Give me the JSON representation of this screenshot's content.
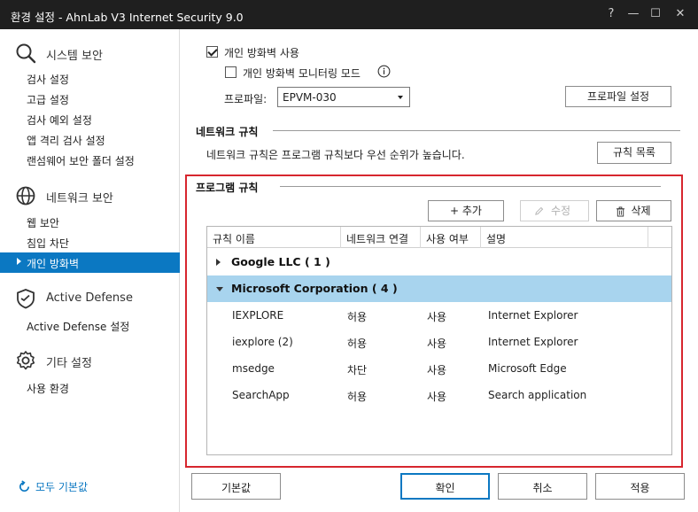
{
  "window": {
    "title": "환경 설정 - AhnLab V3 Internet Security 9.0",
    "help": "?",
    "minimize": "—",
    "maximize": "☐",
    "close": "✕"
  },
  "sidebar": {
    "sections": [
      {
        "title": "시스템 보안",
        "icon": "search-icon",
        "items": [
          "검사 설정",
          "고급 설정",
          "검사 예외 설정",
          "앱 격리 검사 설정",
          "랜섬웨어 보안 폴더 설정"
        ]
      },
      {
        "title": "네트워크 보안",
        "icon": "globe-icon",
        "items": [
          "웹 보안",
          "침입 차단",
          "개인 방화벽"
        ]
      },
      {
        "title": "Active Defense",
        "icon": "shield-icon",
        "items": [
          "Active Defense 설정"
        ]
      },
      {
        "title": "기타 설정",
        "icon": "gear-icon",
        "items": [
          "사용 환경"
        ]
      }
    ],
    "active_item": "개인 방화벽",
    "reset_all": "모두 기본값"
  },
  "firewall": {
    "enable_label": "개인 방화벽 사용",
    "enable_checked": true,
    "monitor_label": "개인 방화벽 모니터링 모드",
    "monitor_checked": false,
    "profile_label": "프로파일:",
    "profile_value": "EPVM-030",
    "profile_settings_button": "프로파일 설정"
  },
  "network_rules": {
    "title": "네트워크 규칙",
    "description": "네트워크 규칙은 프로그램 규칙보다 우선 순위가 높습니다.",
    "list_button": "규칙 목록"
  },
  "program_rules": {
    "title": "프로그램 규칙",
    "add_button": "+ 추가",
    "edit_button": "수정",
    "delete_button": "삭제",
    "columns": [
      "규칙 이름",
      "네트워크 연결",
      "사용 여부",
      "설명"
    ],
    "groups": [
      {
        "name": "Google LLC ( 1 )",
        "expanded": false,
        "selected": false,
        "rows": []
      },
      {
        "name": "Microsoft Corporation ( 4 )",
        "expanded": true,
        "selected": true,
        "rows": [
          {
            "name": "IEXPLORE",
            "connection": "허용",
            "usage": "사용",
            "description": "Internet Explorer"
          },
          {
            "name": "iexplore (2)",
            "connection": "허용",
            "usage": "사용",
            "description": "Internet Explorer"
          },
          {
            "name": "msedge",
            "connection": "차단",
            "usage": "사용",
            "description": "Microsoft Edge"
          },
          {
            "name": "SearchApp",
            "connection": "허용",
            "usage": "사용",
            "description": "Search application"
          }
        ]
      }
    ]
  },
  "footer": {
    "defaults_button": "기본값",
    "ok_button": "확인",
    "cancel_button": "취소",
    "apply_button": "적용"
  },
  "colors": {
    "accent": "#0b78c2",
    "highlight_border": "#d7262e",
    "selected_row": "#a8d4ee"
  }
}
